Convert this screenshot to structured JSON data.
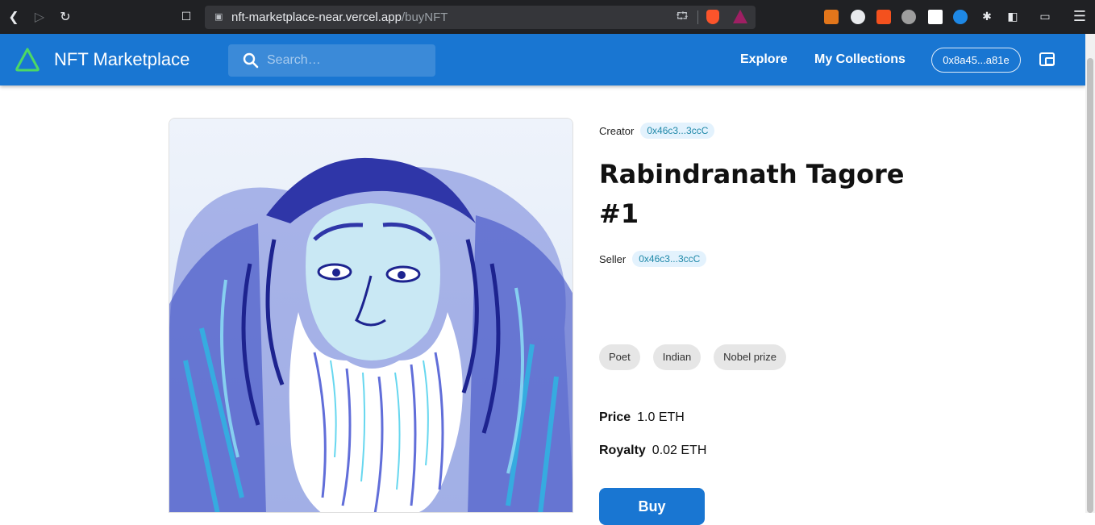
{
  "browser": {
    "url_host": "nft-marketplace-near.vercel.app",
    "url_path": "/buyNFT",
    "icons": [
      "back-icon",
      "forward-icon",
      "reload-icon",
      "bookmark-icon",
      "lock-icon",
      "share-icon",
      "brave-shields-icon",
      "brave-rewards-icon",
      "metamask-icon",
      "extensions-icon",
      "sidebar-icon",
      "wallet-icon",
      "menu-icon"
    ]
  },
  "header": {
    "brand": "NFT Marketplace",
    "search_placeholder": "Search…",
    "nav": {
      "explore": "Explore",
      "my_collections": "My Collections"
    },
    "account": "0x8a45...a81e",
    "accent": "#1976d2",
    "logo_color": "#4cd964"
  },
  "nft": {
    "creator_label": "Creator",
    "creator_address": "0x46c3...3ccC",
    "title": "Rabindranath Tagore #1",
    "seller_label": "Seller",
    "seller_address": "0x46c3...3ccC",
    "tags": [
      "Poet",
      "Indian",
      "Nobel prize"
    ],
    "price_label": "Price",
    "price_value": "1.0 ETH",
    "royalty_label": "Royalty",
    "royalty_value": "0.02 ETH",
    "buy_label": "Buy"
  }
}
